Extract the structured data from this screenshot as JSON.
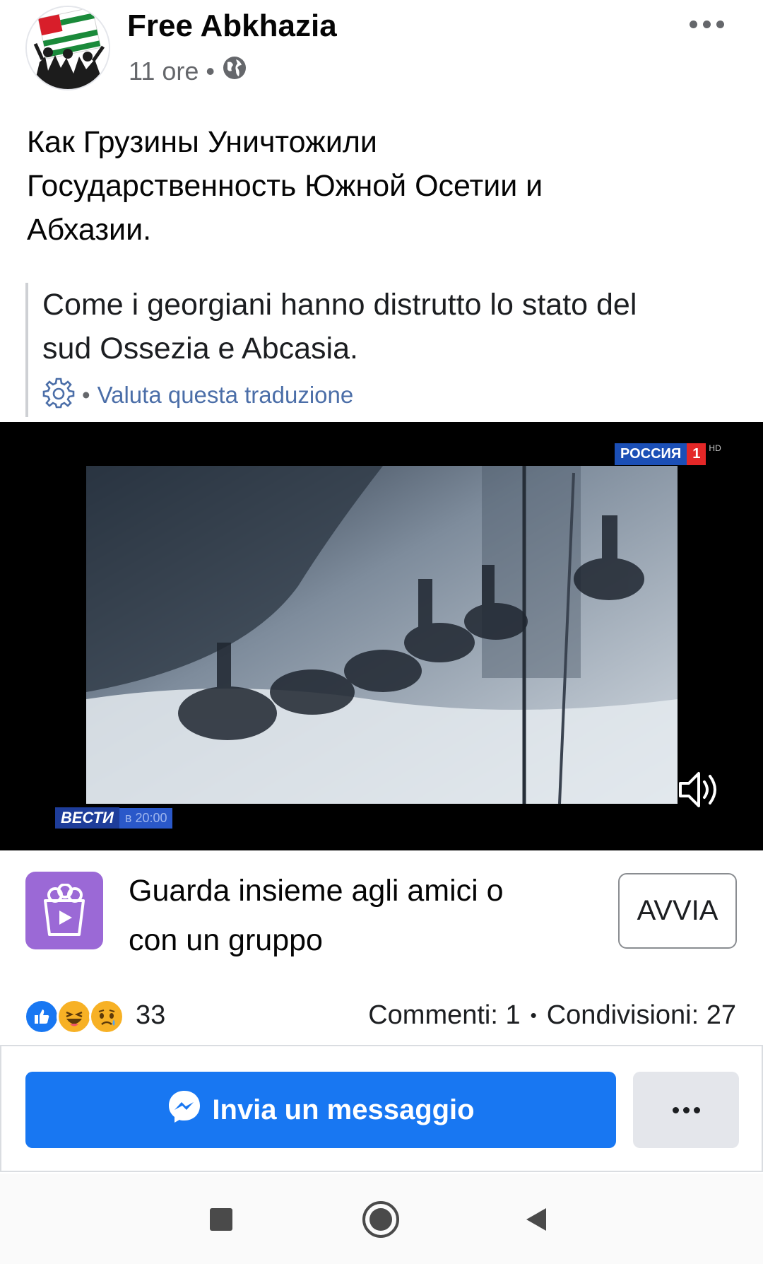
{
  "post": {
    "page_name": "Free Abkhazia",
    "time_ago": "11 ore",
    "separator": "•",
    "privacy_icon": "globe-icon",
    "more_icon": "more-horizontal-icon",
    "text_lines": [
      "Как Грузины Уничтожили",
      "Государственность Южной Осетии и",
      "Абхазии."
    ],
    "translation": {
      "lines": [
        "Come i georgiani hanno distrutto lo stato del",
        "sud Ossezia e Abcasia."
      ],
      "settings_icon": "gear-icon",
      "separator": "•",
      "rate_link": "Valuta questa traduzione"
    }
  },
  "video": {
    "channel_name": "РОССИЯ",
    "channel_number": "1",
    "channel_hd": "HD",
    "news_name": "ВЕСТИ",
    "news_time": "в 20:00",
    "volume_icon": "speaker-icon"
  },
  "watch_party": {
    "icon": "popcorn-icon",
    "lines": [
      "Guarda insieme agli amici o",
      "con un gruppo"
    ],
    "button_label": "AVVIA"
  },
  "reactions": {
    "icons": [
      "like-icon",
      "haha-icon",
      "sad-icon"
    ],
    "count": "33",
    "comments": "Commenti: 1",
    "separator": "•",
    "shares": "Condivisioni: 27"
  },
  "actions": {
    "message_label": "Invia un messaggio",
    "message_icon": "messenger-icon",
    "more_icon": "more-horizontal-icon"
  },
  "navigation": {
    "recents_icon": "square-icon",
    "home_icon": "circle-icon",
    "back_icon": "triangle-back-icon"
  },
  "colors": {
    "accent": "#1877f2",
    "link": "#4b6ea8",
    "muted": "#65676b",
    "watch_icon_bg": "#9b69d6"
  }
}
